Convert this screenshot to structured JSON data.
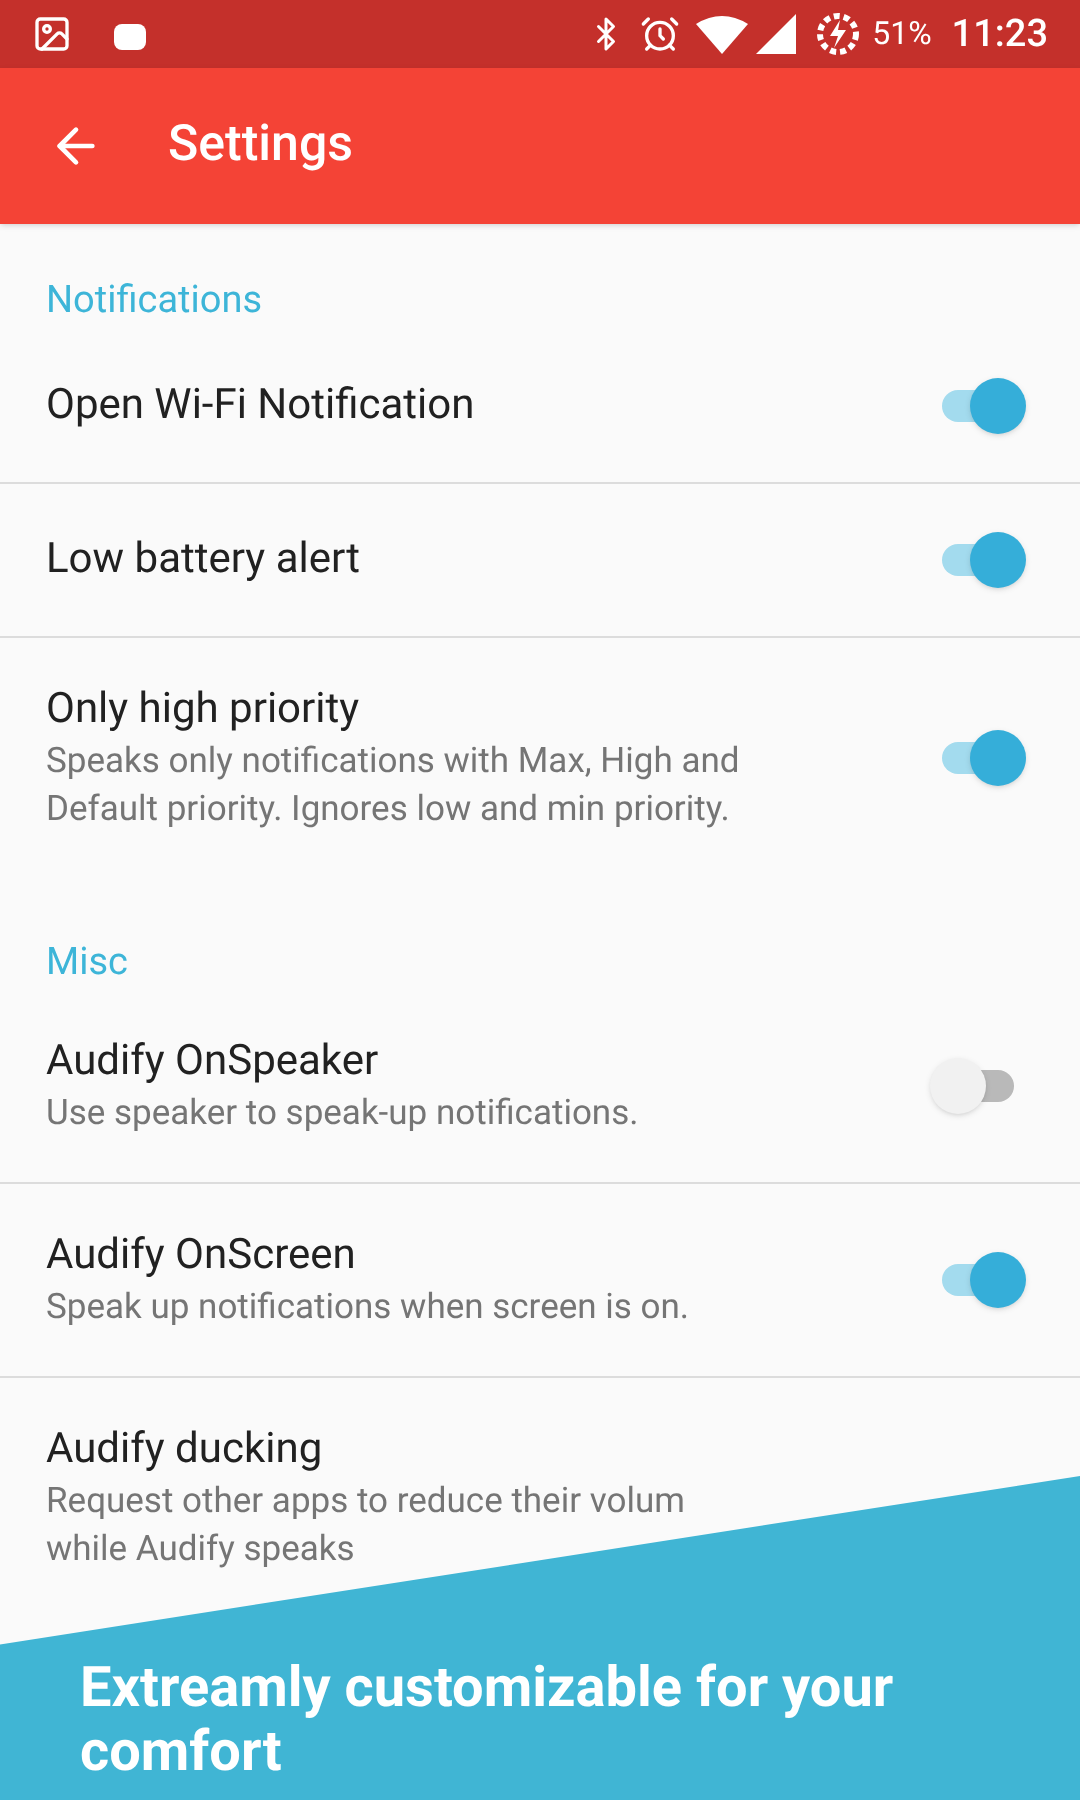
{
  "status_bar": {
    "battery": "51%",
    "time": "11:23"
  },
  "app_bar": {
    "title": "Settings"
  },
  "sections": [
    {
      "header": "Notifications",
      "items": [
        {
          "title": "Open Wi-Fi Notification",
          "on": true
        },
        {
          "title": "Low battery alert",
          "on": true
        },
        {
          "title": "Only high priority",
          "summary": "Speaks only notifications with Max, High and Default priority. Ignores low and min priority.",
          "on": true
        }
      ]
    },
    {
      "header": "Misc",
      "items": [
        {
          "title": "Audify OnSpeaker",
          "summary": "Use speaker to speak-up notifications.",
          "on": false
        },
        {
          "title": "Audify OnScreen",
          "summary": "Speak up notifications when screen is on.",
          "on": true
        },
        {
          "title": "Audify ducking",
          "summary": "Request other apps to reduce their volum\nwhile Audify speaks"
        }
      ]
    }
  ],
  "banner": {
    "text": "Extreamly customizable for your comfort"
  }
}
